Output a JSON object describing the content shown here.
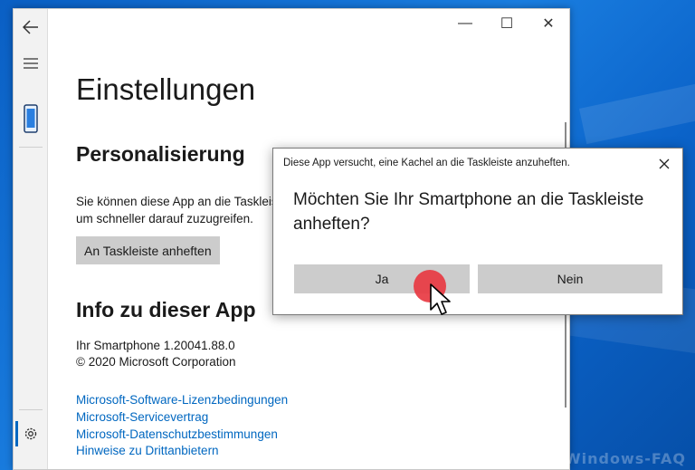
{
  "window": {
    "title_buttons": [
      {
        "name": "minimize",
        "glyph": "—"
      },
      {
        "name": "maximize",
        "glyph": "☐"
      },
      {
        "name": "close",
        "glyph": "✕"
      }
    ]
  },
  "nav": {
    "icons": [
      "back-arrow-icon",
      "hamburger-menu-icon",
      "smartphone-icon",
      "gear-icon"
    ]
  },
  "content": {
    "page_title": "Einstellungen",
    "personalization": {
      "heading": "Personalisierung",
      "description": "Sie können diese App an die Taskleiste anheften, um schneller darauf zuzugreifen.",
      "button": "An Taskleiste anheften"
    },
    "about": {
      "heading": "Info zu dieser App",
      "version": "Ihr Smartphone 1.20041.88.0",
      "copyright": "© 2020 Microsoft Corporation"
    },
    "links": [
      "Microsoft-Software-Lizenzbedingungen",
      "Microsoft-Servicevertrag",
      "Microsoft-Datenschutzbestimmungen",
      "Hinweise zu Drittanbietern"
    ]
  },
  "dialog": {
    "caption": "Diese App versucht, eine Kachel an die Taskleiste anzuheften.",
    "question": "Möchten Sie Ihr Smartphone an die Taskleiste anheften?",
    "yes": "Ja",
    "no": "Nein"
  },
  "watermark": "Windows-FAQ",
  "colors": {
    "accent": "#0067c0",
    "desktop": "#0a5fc4",
    "button_bg": "#cccccc",
    "click_indicator": "#e83a42"
  }
}
